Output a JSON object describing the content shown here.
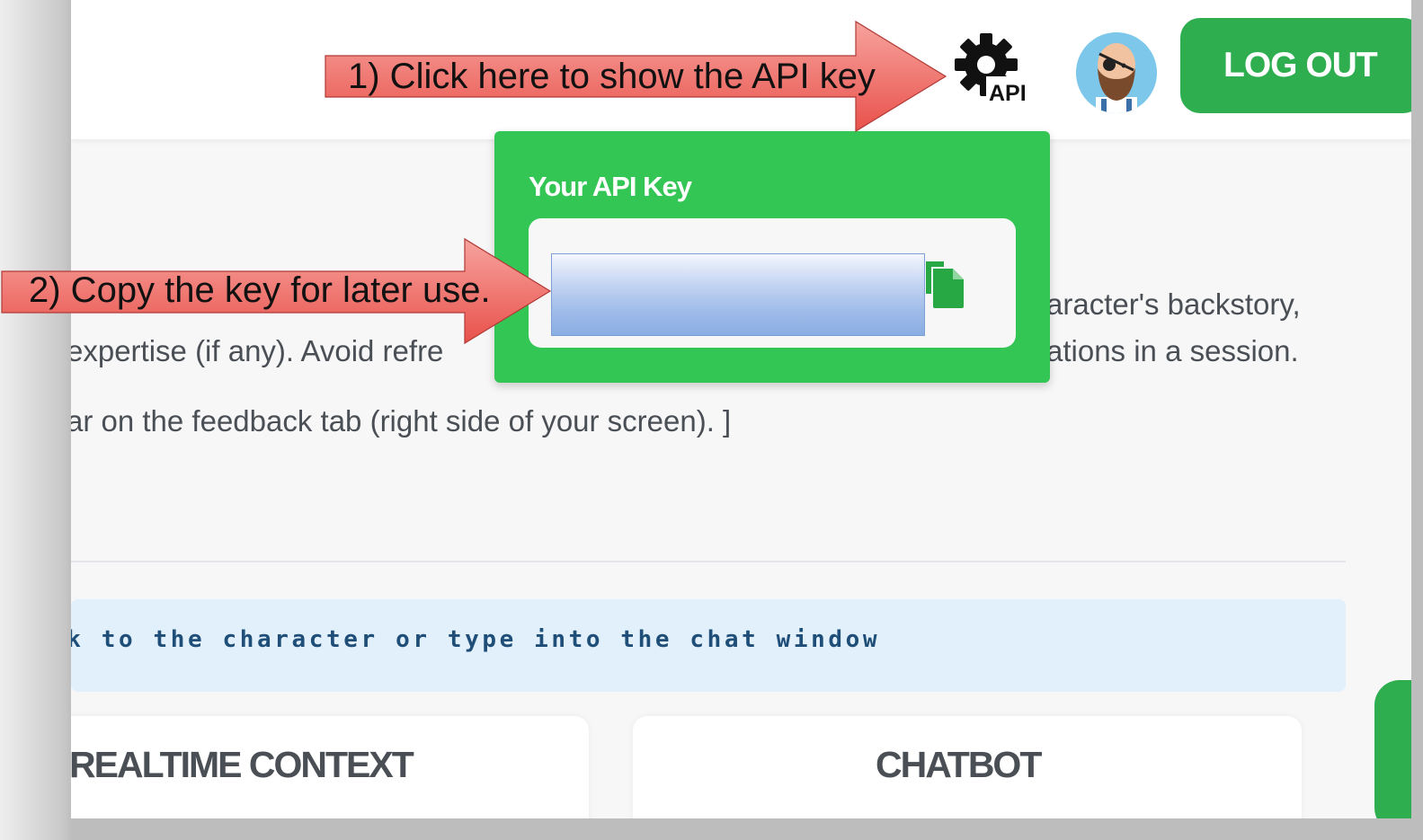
{
  "header": {
    "api_badge": "API",
    "logout_label": "LOG OUT"
  },
  "content": {
    "line1_right": "aracter's backstory,",
    "line2_left": "expertise (if any). Avoid refre",
    "line2_right": "ations in a session.",
    "line3": "ar on the feedback tab (right side of your screen). ]"
  },
  "instruction_bar": {
    "text": "ak to the character or type into the chat window"
  },
  "cards": {
    "left_title": "REALTIME CONTEXT",
    "right_title": "CHATBOT"
  },
  "api_popup": {
    "title": "Your API Key"
  },
  "callouts": {
    "step1": "1) Click here to show the API key",
    "step2": "2) Copy the key for later use."
  },
  "colors": {
    "brand_green": "#2eae4f",
    "popup_green": "#33c654",
    "callout_red": "#ee6b66",
    "instruction_bg": "#e2f0fb",
    "instruction_text": "#1f4e79"
  },
  "icons": [
    "gear-icon",
    "avatar",
    "copy-icon"
  ]
}
